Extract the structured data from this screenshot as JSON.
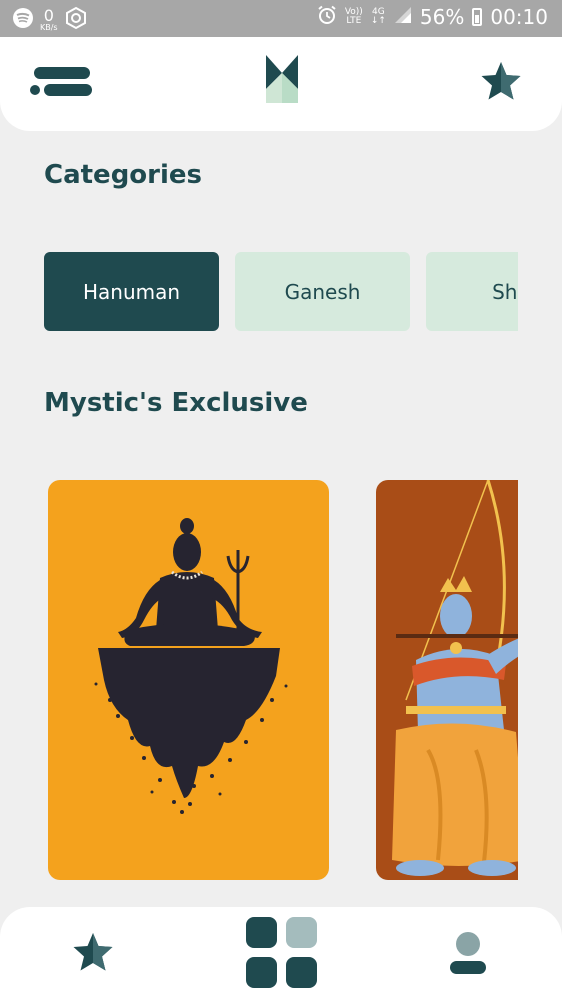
{
  "status_bar": {
    "data_rate_value": "0",
    "data_rate_unit": "KB/s",
    "volte_line1": "Vo))",
    "volte_line2": "LTE",
    "network_top": "4G",
    "network_bottom": "↓↑",
    "battery_percent": "56%",
    "time": "00:10",
    "icons": [
      "spotify-icon",
      "data-saver-icon",
      "alarm-icon",
      "signal-icon",
      "battery-icon"
    ]
  },
  "header": {
    "menu_icon": "menu-icon",
    "logo": "mystic-logo",
    "favorite_icon": "star-icon"
  },
  "categories": {
    "title": "Categories",
    "items": [
      {
        "label": "Hanuman",
        "selected": true
      },
      {
        "label": "Ganesh",
        "selected": false
      },
      {
        "label": "Shiv",
        "selected": false
      }
    ]
  },
  "exclusive": {
    "title": "Mystic's Exclusive",
    "cards": [
      {
        "illustration": "shiva-meditating-illustration"
      },
      {
        "illustration": "rama-archer-illustration"
      }
    ]
  },
  "bottom_nav": {
    "items": [
      "favorites-star-icon",
      "grid-home-icon",
      "profile-icon"
    ]
  },
  "colors": {
    "primary": "#1f4a4f",
    "chip_inactive": "#d6eadd",
    "shiva_card": "#f4a21d",
    "ram_card": "#a94d17",
    "background": "#efefef"
  }
}
